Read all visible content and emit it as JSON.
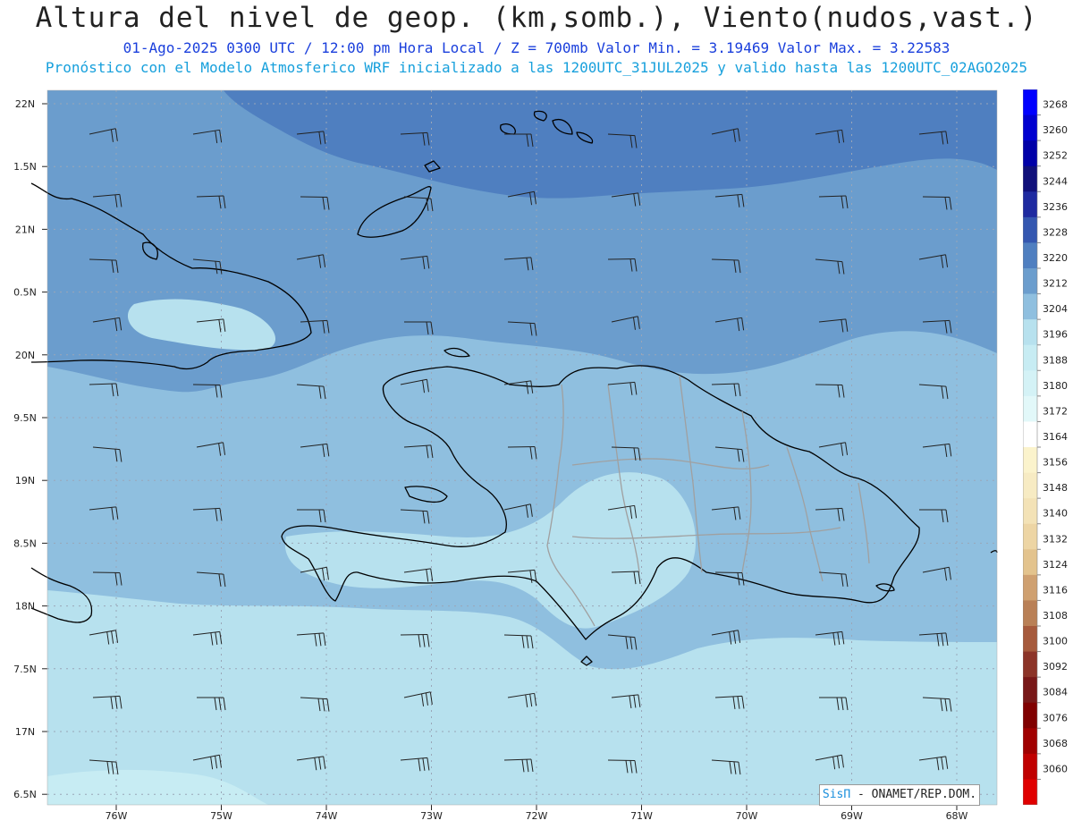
{
  "header": {
    "title": "Altura del nivel de geop. (km,somb.), Viento(nudos,vast.)",
    "subtitle": "01-Ago-2025  0300 UTC / 12:00 pm Hora Local / Z = 700mb   Valor Min. = 3.19469  Valor Max. = 3.22583",
    "model_info": "Pronóstico con el Modelo Atmosferico WRF inicializado a las 1200UTC_31JUL2025 y valido hasta las  1200UTC_02AGO2025"
  },
  "axes": {
    "lat_labels": [
      "22N",
      "1.5N",
      "21N",
      "0.5N",
      "20N",
      "9.5N",
      "19N",
      "8.5N",
      "18N",
      "7.5N",
      "17N",
      "6.5N"
    ],
    "lon_labels": [
      "76W",
      "75W",
      "74W",
      "73W",
      "72W",
      "71W",
      "70W",
      "69W",
      "68W"
    ]
  },
  "colorbar": {
    "labels": [
      "3268",
      "3260",
      "3252",
      "3244",
      "3236",
      "3228",
      "3220",
      "3212",
      "3204",
      "3196",
      "3188",
      "3180",
      "3172",
      "3164",
      "3156",
      "3148",
      "3140",
      "3132",
      "3124",
      "3116",
      "3108",
      "3100",
      "3092",
      "3084",
      "3076",
      "3068",
      "3060"
    ],
    "colors": [
      "#0000ff",
      "#0000d0",
      "#0000a8",
      "#10107a",
      "#1e2aa0",
      "#3457b0",
      "#4f7fc0",
      "#6b9dcd",
      "#8fbfdf",
      "#b7e1ee",
      "#c7ecf3",
      "#d4f2f6",
      "#e2f8f9",
      "#ffffff",
      "#fbf3cc",
      "#f7ebc3",
      "#f3e2b6",
      "#edd5a4",
      "#e3c38d",
      "#cfa070",
      "#b98056",
      "#a65a3c",
      "#8c3428",
      "#781818",
      "#800000",
      "#a00000",
      "#c00000",
      "#e00000"
    ]
  },
  "credit": {
    "brand": "SisΠ",
    "text": "- ONAMET/REP.DOM."
  },
  "colors": {
    "band_3220": "#4f7fc0",
    "band_3212": "#6b9dcd",
    "band_3204": "#8fbfdf",
    "band_3196": "#b7e1ee",
    "band_3188": "#c7ecf3",
    "coast": "#000000",
    "borders": "#a0a0a0"
  }
}
